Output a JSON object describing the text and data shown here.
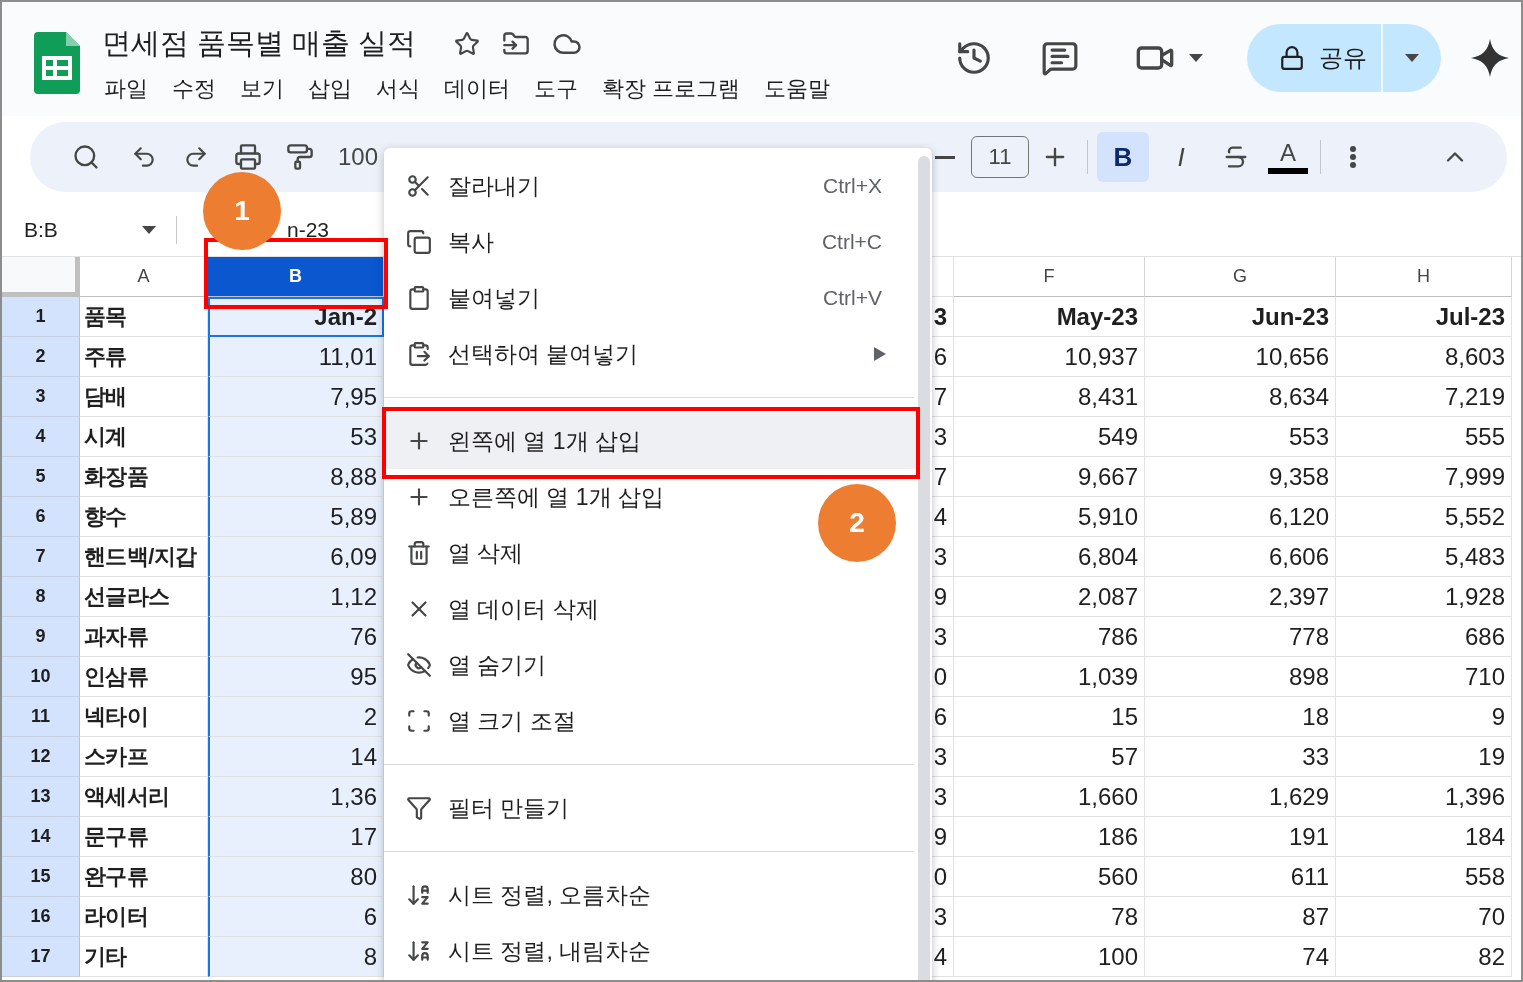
{
  "document": {
    "title": "면세점 품목별 매출 실적",
    "menus": [
      "파일",
      "수정",
      "보기",
      "삽입",
      "서식",
      "데이터",
      "도구",
      "확장 프로그램",
      "도움말"
    ]
  },
  "share_button": {
    "label": "공유"
  },
  "toolbar": {
    "zoom": "100",
    "font_size": "11",
    "format_buttons": [
      {
        "label": "B",
        "selected": true
      },
      {
        "label": "I",
        "selected": false
      }
    ],
    "text_color_label": "A"
  },
  "formula_bar": {
    "name_box": "B:B",
    "formula": "n-23"
  },
  "columns": [
    {
      "kind": "full",
      "label": "A",
      "selected": false
    },
    {
      "kind": "full",
      "label": "B",
      "selected": true
    },
    {
      "kind": "covered"
    },
    {
      "kind": "sliver"
    },
    {
      "kind": "full",
      "label": "F",
      "selected": false
    },
    {
      "kind": "full",
      "label": "G",
      "selected": false
    },
    {
      "kind": "full",
      "label": "H",
      "selected": false
    }
  ],
  "rows": [
    {
      "number": "1",
      "selected": true,
      "cells": [
        "품목",
        "Jan-2",
        "3",
        "May-23",
        "Jun-23",
        "Jul-23"
      ]
    },
    {
      "number": "2",
      "selected": true,
      "cells": [
        "주류",
        "11,01",
        "6",
        "10,937",
        "10,656",
        "8,603"
      ]
    },
    {
      "number": "3",
      "selected": true,
      "cells": [
        "담배",
        "7,95",
        "7",
        "8,431",
        "8,634",
        "7,219"
      ]
    },
    {
      "number": "4",
      "selected": true,
      "cells": [
        "시계",
        "53",
        "3",
        "549",
        "553",
        "555"
      ]
    },
    {
      "number": "5",
      "selected": true,
      "cells": [
        "화장품",
        "8,88",
        "7",
        "9,667",
        "9,358",
        "7,999"
      ]
    },
    {
      "number": "6",
      "selected": true,
      "cells": [
        "향수",
        "5,89",
        "4",
        "5,910",
        "6,120",
        "5,552"
      ]
    },
    {
      "number": "7",
      "selected": true,
      "cells": [
        "핸드백/지갑",
        "6,09",
        "3",
        "6,804",
        "6,606",
        "5,483"
      ]
    },
    {
      "number": "8",
      "selected": true,
      "cells": [
        "선글라스",
        "1,12",
        "9",
        "2,087",
        "2,397",
        "1,928"
      ]
    },
    {
      "number": "9",
      "selected": true,
      "cells": [
        "과자류",
        "76",
        "3",
        "786",
        "778",
        "686"
      ]
    },
    {
      "number": "10",
      "selected": true,
      "cells": [
        "인삼류",
        "95",
        "0",
        "1,039",
        "898",
        "710"
      ]
    },
    {
      "number": "11",
      "selected": true,
      "cells": [
        "넥타이",
        "2",
        "6",
        "15",
        "18",
        "9"
      ]
    },
    {
      "number": "12",
      "selected": true,
      "cells": [
        "스카프",
        "14",
        "3",
        "57",
        "33",
        "19"
      ]
    },
    {
      "number": "13",
      "selected": true,
      "cells": [
        "액세서리",
        "1,36",
        "3",
        "1,660",
        "1,629",
        "1,396"
      ]
    },
    {
      "number": "14",
      "selected": true,
      "cells": [
        "문구류",
        "17",
        "9",
        "186",
        "191",
        "184"
      ]
    },
    {
      "number": "15",
      "selected": true,
      "cells": [
        "완구류",
        "80",
        "0",
        "560",
        "611",
        "558"
      ]
    },
    {
      "number": "16",
      "selected": true,
      "cells": [
        "라이터",
        "6",
        "3",
        "78",
        "87",
        "70"
      ]
    },
    {
      "number": "17",
      "selected": true,
      "cells": [
        "기타",
        "8",
        "4",
        "100",
        "74",
        "82"
      ]
    }
  ],
  "context_menu": [
    {
      "kind": "item",
      "label": "잘라내기",
      "shortcut": "Ctrl+X",
      "selected": false
    },
    {
      "kind": "item",
      "label": "복사",
      "shortcut": "Ctrl+C",
      "selected": false
    },
    {
      "kind": "item",
      "label": "붙여넣기",
      "shortcut": "Ctrl+V",
      "selected": false
    },
    {
      "kind": "item",
      "label": "선택하여 붙여넣기",
      "submenu": true,
      "selected": false
    },
    {
      "kind": "divider"
    },
    {
      "kind": "item",
      "label": "왼쪽에 열 1개 삽입",
      "selected": true
    },
    {
      "kind": "item",
      "label": "오른쪽에 열 1개 삽입",
      "selected": false
    },
    {
      "kind": "item",
      "label": "열 삭제",
      "selected": false
    },
    {
      "kind": "item",
      "label": "열 데이터 삭제",
      "selected": false
    },
    {
      "kind": "item",
      "label": "열 숨기기",
      "selected": false
    },
    {
      "kind": "item",
      "label": "열 크기 조절",
      "selected": false
    },
    {
      "kind": "divider"
    },
    {
      "kind": "item",
      "label": "필터 만들기",
      "selected": false
    },
    {
      "kind": "divider"
    },
    {
      "kind": "item",
      "label": "시트 정렬, 오름차순",
      "selected": false
    },
    {
      "kind": "item",
      "label": "시트 정렬, 내림차순",
      "selected": false
    }
  ],
  "callouts": [
    {
      "label": "1"
    },
    {
      "label": "2"
    }
  ]
}
